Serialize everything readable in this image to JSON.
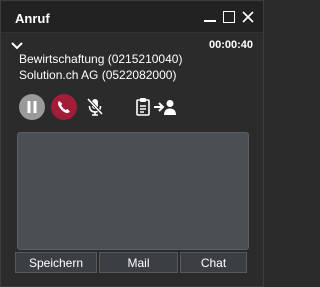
{
  "window": {
    "title": "Anruf",
    "controls": [
      "minimize-icon",
      "maximize-icon",
      "close-icon"
    ]
  },
  "call": {
    "timer": "00:00:40",
    "line1": "Bewirtschaftung (0215210040)",
    "line2": "Solution.ch AG (0522082000)"
  },
  "actions": {
    "icons": [
      "pause-icon",
      "hangup-icon",
      "mute-icon",
      "transfer-document-icon",
      "transfer-person-icon"
    ],
    "colors": {
      "pause": "#9a9a9a",
      "hangup": "#a11d38"
    }
  },
  "notes": {
    "value": ""
  },
  "bottom": {
    "save_label": "Speichern",
    "mail_label": "Mail",
    "chat_label": "Chat"
  }
}
